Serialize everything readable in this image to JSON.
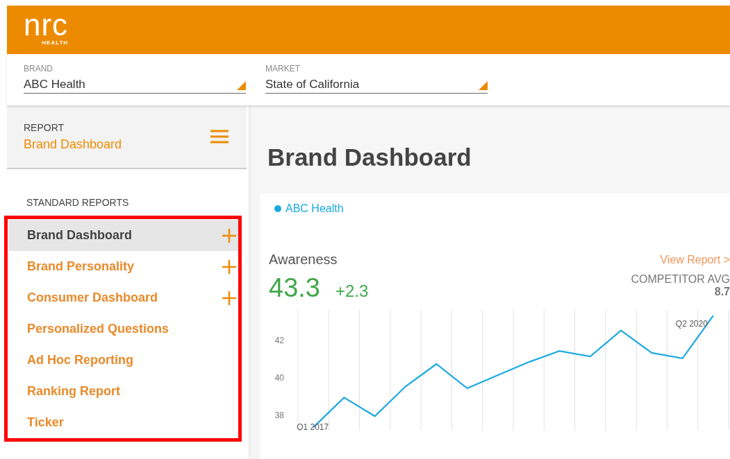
{
  "header": {
    "logo_text": "nrc",
    "logo_subtext": "HEALTH"
  },
  "filters": [
    {
      "label": "BRAND",
      "value": "ABC Health"
    },
    {
      "label": "MARKET",
      "value": "State of California"
    }
  ],
  "sidebar": {
    "report_label": "REPORT",
    "report_value": "Brand Dashboard",
    "section_title": "STANDARD REPORTS",
    "highlighted": true,
    "items": [
      {
        "label": "Brand Dashboard",
        "selected": true,
        "expandable": true
      },
      {
        "label": "Brand Personality",
        "selected": false,
        "expandable": true
      },
      {
        "label": "Consumer Dashboard",
        "selected": false,
        "expandable": true
      },
      {
        "label": "Personalized Questions",
        "selected": false,
        "expandable": false
      },
      {
        "label": "Ad Hoc Reporting",
        "selected": false,
        "expandable": false
      },
      {
        "label": "Ranking Report",
        "selected": false,
        "expandable": false
      },
      {
        "label": "Ticker",
        "selected": false,
        "expandable": false
      }
    ]
  },
  "main": {
    "title": "Brand Dashboard",
    "metric": {
      "name": "Awareness",
      "link": "View Report >",
      "value": "43.3",
      "change": "+2.3",
      "competitor_label": "COMPETITOR AVG",
      "competitor_value": "8.7",
      "chart_data": {
        "type": "line",
        "categories": [
          null,
          null,
          null,
          null,
          null,
          null,
          null,
          null,
          null,
          null,
          null,
          null,
          null,
          null
        ],
        "series": [
          {
            "name": "ABC Health",
            "color": "#1ba9e1",
            "values": [
              37.3,
              38.9,
              37.9,
              39.5,
              40.7,
              39.4,
              40.1,
              40.8,
              41.4,
              41.1,
              42.5,
              41.3,
              41.0,
              43.3
            ]
          }
        ],
        "annotations": [
          {
            "text": "Q1 2017"
          },
          {
            "text": "Q2 2020"
          }
        ],
        "yticks": [
          {
            "value": 38,
            "label": "38"
          },
          {
            "value": 40,
            "label": "40"
          },
          {
            "value": 42,
            "label": "42"
          }
        ],
        "ylim": [
          37.13,
          43.6
        ]
      }
    }
  }
}
